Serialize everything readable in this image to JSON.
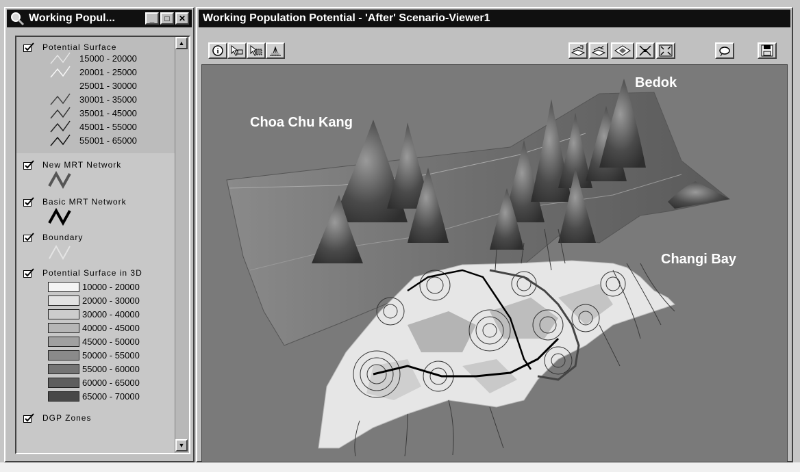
{
  "legend_window": {
    "title": "Working Popul...",
    "controls": {
      "minimize": "_",
      "maximize": "□",
      "close": "✕"
    },
    "potential_surface": {
      "label": "Potential Surface",
      "ranges": [
        "15000 - 20000",
        "20001 - 25000",
        "25001 - 30000",
        "30001 - 35000",
        "35001 - 45000",
        "45001 - 55000",
        "55001 - 65000"
      ]
    },
    "new_mrt": {
      "label": "New MRT Network"
    },
    "basic_mrt": {
      "label": "Basic MRT Network"
    },
    "boundary": {
      "label": "Boundary"
    },
    "surface_3d": {
      "label": "Potential Surface in 3D",
      "ranges": [
        "10000 - 20000",
        "20000 - 30000",
        "30000 - 40000",
        "40000 - 45000",
        "45000 - 50000",
        "50000 - 55000",
        "55000 - 60000",
        "60000 - 65000",
        "65000 - 70000"
      ],
      "colors": [
        "#f4f4f4",
        "#e2e2e2",
        "#cccccc",
        "#b6b6b6",
        "#a0a0a0",
        "#8a8a8a",
        "#747474",
        "#5e5e5e",
        "#484848"
      ]
    },
    "dgp_zones": {
      "label": "DGP Zones"
    }
  },
  "viewer_window": {
    "title": "Working Population Potential - 'After' Scenario-Viewer1",
    "tools_left": [
      "info-tool",
      "select-tool",
      "area-select-tool",
      "navigate-tool"
    ],
    "tools_right": [
      "layer-on-tool",
      "layer-off-tool",
      "theme-tool",
      "zoom-in-tool",
      "zoom-out-tool",
      "refresh-tool",
      "save-tool"
    ],
    "places": {
      "choa_chu_kang": "Choa Chu Kang",
      "bedok": "Bedok",
      "changi_bay": "Changi Bay"
    }
  }
}
